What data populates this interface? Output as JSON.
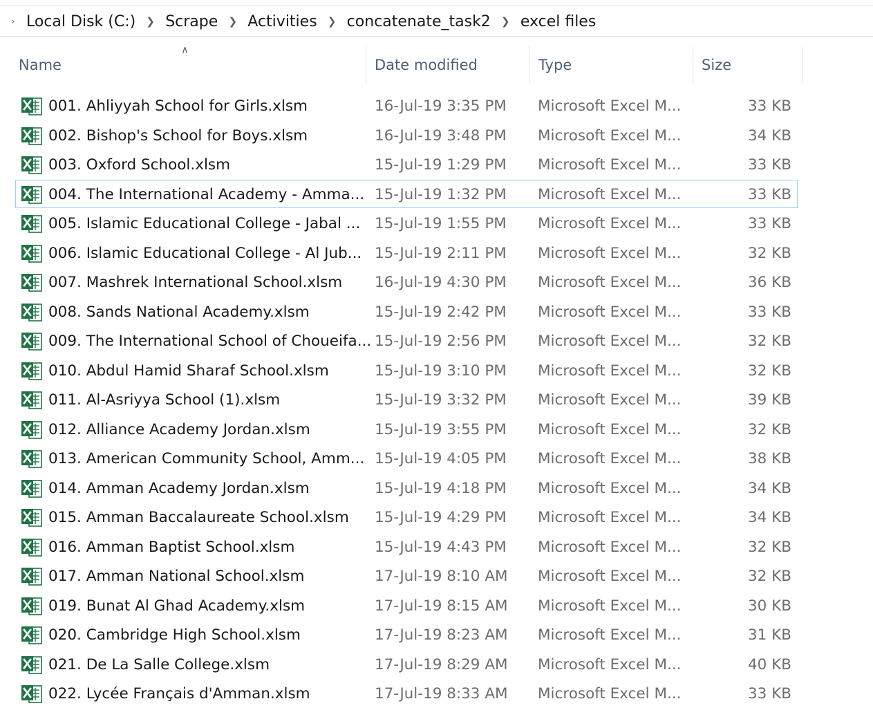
{
  "breadcrumb": {
    "items": [
      "Local Disk (C:)",
      "Scrape",
      "Activities",
      "concatenate_task2",
      "excel files"
    ]
  },
  "columns": {
    "name": "Name",
    "date": "Date modified",
    "type": "Type",
    "size": "Size"
  },
  "icons": {
    "file_icon": "excel-file-icon",
    "sort_indicator": "sort-ascending-icon",
    "excel_green": "#217346"
  },
  "files": [
    {
      "name": "001. Ahliyyah School for Girls.xlsm",
      "date": "16-Jul-19 3:35 PM",
      "type": "Microsoft Excel M...",
      "size": "33 KB"
    },
    {
      "name": "002. Bishop's School for Boys.xlsm",
      "date": "16-Jul-19 3:48 PM",
      "type": "Microsoft Excel M...",
      "size": "34 KB"
    },
    {
      "name": "003. Oxford School.xlsm",
      "date": "15-Jul-19 1:29 PM",
      "type": "Microsoft Excel M...",
      "size": "33 KB"
    },
    {
      "name": "004. The International Academy - Amma...",
      "date": "15-Jul-19 1:32 PM",
      "type": "Microsoft Excel M...",
      "size": "33 KB",
      "focused": true
    },
    {
      "name": "005. Islamic Educational College - Jabal ...",
      "date": "15-Jul-19 1:55 PM",
      "type": "Microsoft Excel M...",
      "size": "33 KB"
    },
    {
      "name": "006. Islamic Educational College - Al Jub...",
      "date": "15-Jul-19 2:11 PM",
      "type": "Microsoft Excel M...",
      "size": "32 KB"
    },
    {
      "name": "007. Mashrek International School.xlsm",
      "date": "16-Jul-19 4:30 PM",
      "type": "Microsoft Excel M...",
      "size": "36 KB"
    },
    {
      "name": "008. Sands National Academy.xlsm",
      "date": "15-Jul-19 2:42 PM",
      "type": "Microsoft Excel M...",
      "size": "33 KB"
    },
    {
      "name": "009. The International School of Choueifa...",
      "date": "15-Jul-19 2:56 PM",
      "type": "Microsoft Excel M...",
      "size": "32 KB"
    },
    {
      "name": "010. Abdul Hamid Sharaf School.xlsm",
      "date": "15-Jul-19 3:10 PM",
      "type": "Microsoft Excel M...",
      "size": "32 KB"
    },
    {
      "name": "011. Al-Asriyya School (1).xlsm",
      "date": "15-Jul-19 3:32 PM",
      "type": "Microsoft Excel M...",
      "size": "39 KB"
    },
    {
      "name": "012. Alliance Academy Jordan.xlsm",
      "date": "15-Jul-19 3:55 PM",
      "type": "Microsoft Excel M...",
      "size": "32 KB"
    },
    {
      "name": "013. American Community School, Amm...",
      "date": "15-Jul-19 4:05 PM",
      "type": "Microsoft Excel M...",
      "size": "38 KB"
    },
    {
      "name": "014. Amman Academy Jordan.xlsm",
      "date": "15-Jul-19 4:18 PM",
      "type": "Microsoft Excel M...",
      "size": "34 KB"
    },
    {
      "name": "015. Amman Baccalaureate School.xlsm",
      "date": "15-Jul-19 4:29 PM",
      "type": "Microsoft Excel M...",
      "size": "34 KB"
    },
    {
      "name": "016. Amman Baptist School.xlsm",
      "date": "15-Jul-19 4:43 PM",
      "type": "Microsoft Excel M...",
      "size": "32 KB"
    },
    {
      "name": "017. Amman National School.xlsm",
      "date": "17-Jul-19 8:10 AM",
      "type": "Microsoft Excel M...",
      "size": "32 KB"
    },
    {
      "name": "019. Bunat Al Ghad Academy.xlsm",
      "date": "17-Jul-19 8:15 AM",
      "type": "Microsoft Excel M...",
      "size": "30 KB"
    },
    {
      "name": "020. Cambridge High School.xlsm",
      "date": "17-Jul-19 8:23 AM",
      "type": "Microsoft Excel M...",
      "size": "31 KB"
    },
    {
      "name": "021. De La Salle College.xlsm",
      "date": "17-Jul-19 8:29 AM",
      "type": "Microsoft Excel M...",
      "size": "40 KB"
    },
    {
      "name": "022. Lycée Français d'Amman.xlsm",
      "date": "17-Jul-19 8:33 AM",
      "type": "Microsoft Excel M...",
      "size": "33 KB"
    }
  ]
}
